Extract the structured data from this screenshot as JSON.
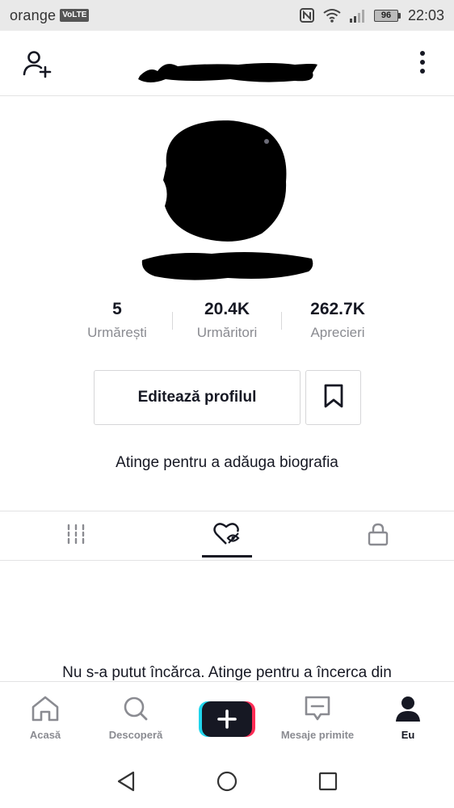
{
  "status_bar": {
    "carrier": "orange",
    "network_badge": "VoLTE",
    "battery_level": "96",
    "time": "22:03",
    "icons": [
      "nfc-icon",
      "wifi-icon",
      "signal-icon",
      "battery-icon"
    ]
  },
  "header": {
    "left_icon": "add-user-icon",
    "right_icon": "more-vertical-icon"
  },
  "profile": {
    "stats": [
      {
        "value": "5",
        "label": "Urmărești"
      },
      {
        "value": "20.4K",
        "label": "Urmăritori"
      },
      {
        "value": "262.7K",
        "label": "Aprecieri"
      }
    ],
    "edit_button": "Editează profilul",
    "bookmark_icon": "bookmark-icon",
    "bio_prompt": "Atinge pentru a adăuga biografia"
  },
  "tabs": {
    "items": [
      {
        "icon": "videos-grid-icon"
      },
      {
        "icon": "liked-heart-icon"
      },
      {
        "icon": "lock-icon"
      }
    ],
    "active_index": 1
  },
  "content": {
    "error_message": "Nu s-a putut încărca. Atinge pentru a încerca din"
  },
  "bottom_nav": {
    "items": [
      {
        "label": "Acasă",
        "icon": "home-icon"
      },
      {
        "label": "Descoperă",
        "icon": "search-icon"
      },
      {
        "label": "",
        "icon": "plus-icon"
      },
      {
        "label": "Mesaje primite",
        "icon": "inbox-icon"
      },
      {
        "label": "Eu",
        "icon": "profile-icon"
      }
    ],
    "active": "Eu"
  },
  "colors": {
    "text_primary": "#161823",
    "text_secondary": "#8a8b91",
    "accent_cyan": "#20d5ec",
    "accent_pink": "#fe2c55",
    "border": "#e3e3e4"
  }
}
